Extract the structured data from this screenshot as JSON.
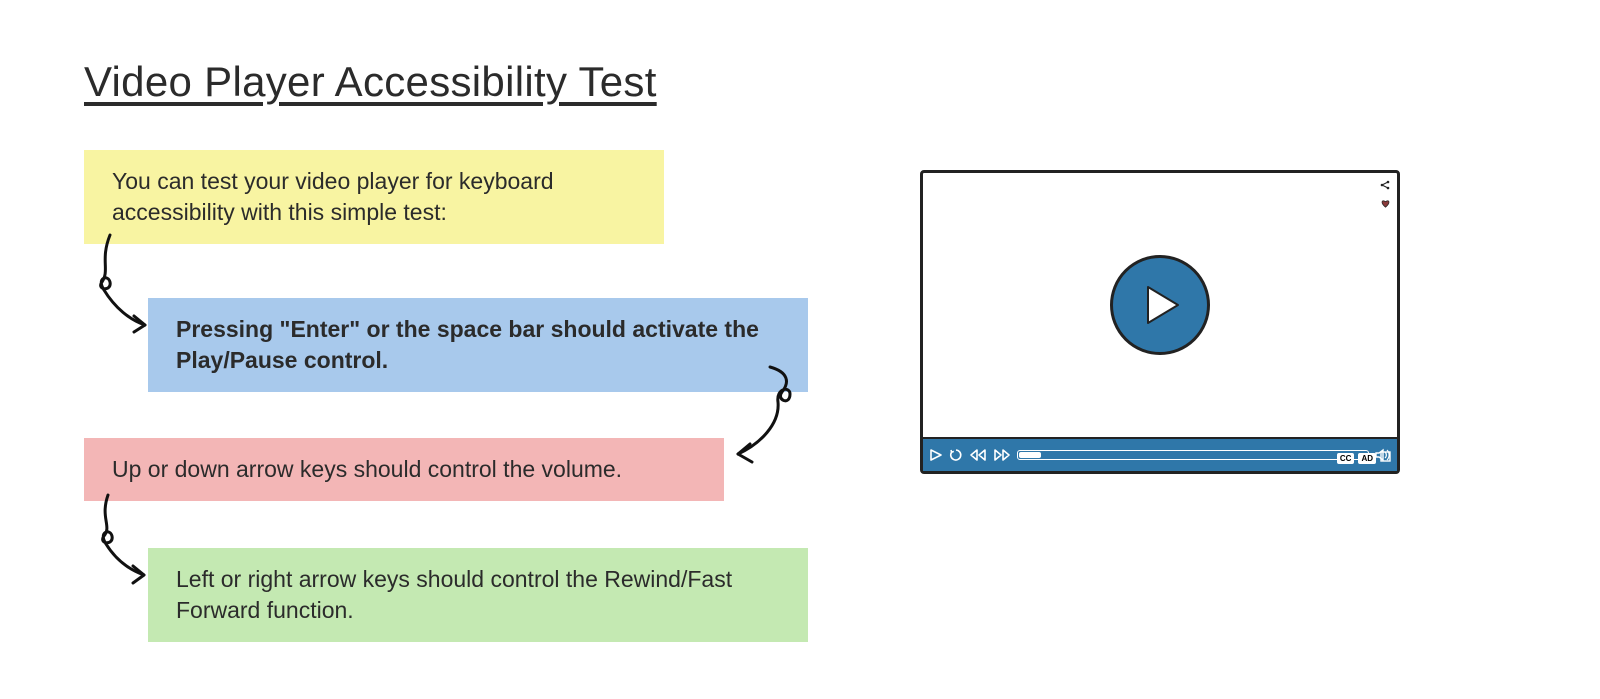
{
  "title": "Video Player Accessibility Test",
  "notes": {
    "intro": "You can test your video player for keyboard accessibility with this simple test:",
    "enter": "Pressing \"Enter\" or the space bar should activate the Play/Pause control.",
    "volume": "Up or down arrow keys should control the volume.",
    "seek": "Left or right arrow keys should control the Rewind/Fast Forward function."
  },
  "player": {
    "cc_label": "CC",
    "ad_label": "AD"
  },
  "colors": {
    "yellow": "#f8f4a2",
    "blue": "#a8c9ec",
    "pink": "#f3b6b6",
    "green": "#c4e9b2",
    "player_blue": "#2f77a9"
  }
}
